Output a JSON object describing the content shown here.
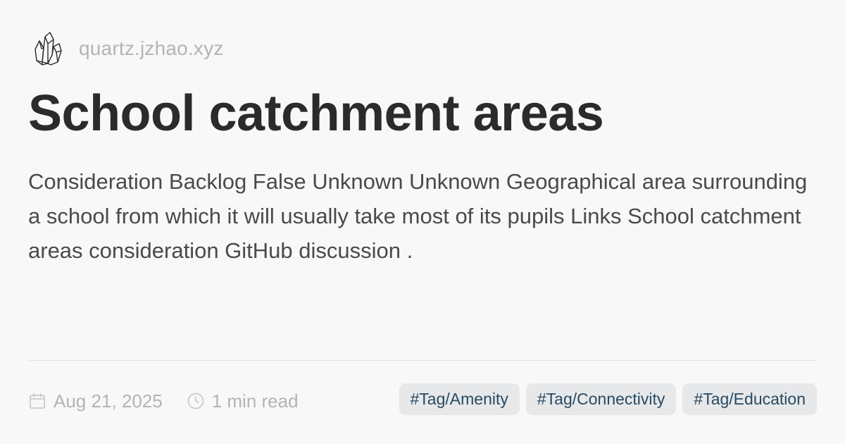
{
  "header": {
    "logo_icon": "crystal-cluster-icon",
    "site_name": "quartz.jzhao.xyz"
  },
  "article": {
    "title": "School catchment areas",
    "description": "Consideration Backlog False Unknown Unknown Geographical area surrounding a school from which it will usually take most of its pupils Links School catchment areas consideration GitHub discussion ."
  },
  "meta": {
    "date_icon": "calendar-icon",
    "date": "Aug 21, 2025",
    "reading_icon": "clock-icon",
    "reading_time": "1 min read"
  },
  "tags": [
    "#Tag/Amenity",
    "#Tag/Connectivity",
    "#Tag/Education"
  ],
  "colors": {
    "background": "#f9f8f9",
    "title": "#2b2b2b",
    "body_text": "#4a4a4a",
    "muted": "#b4b4b4",
    "tag_bg": "#e7e8ea",
    "tag_text": "#284b63"
  }
}
